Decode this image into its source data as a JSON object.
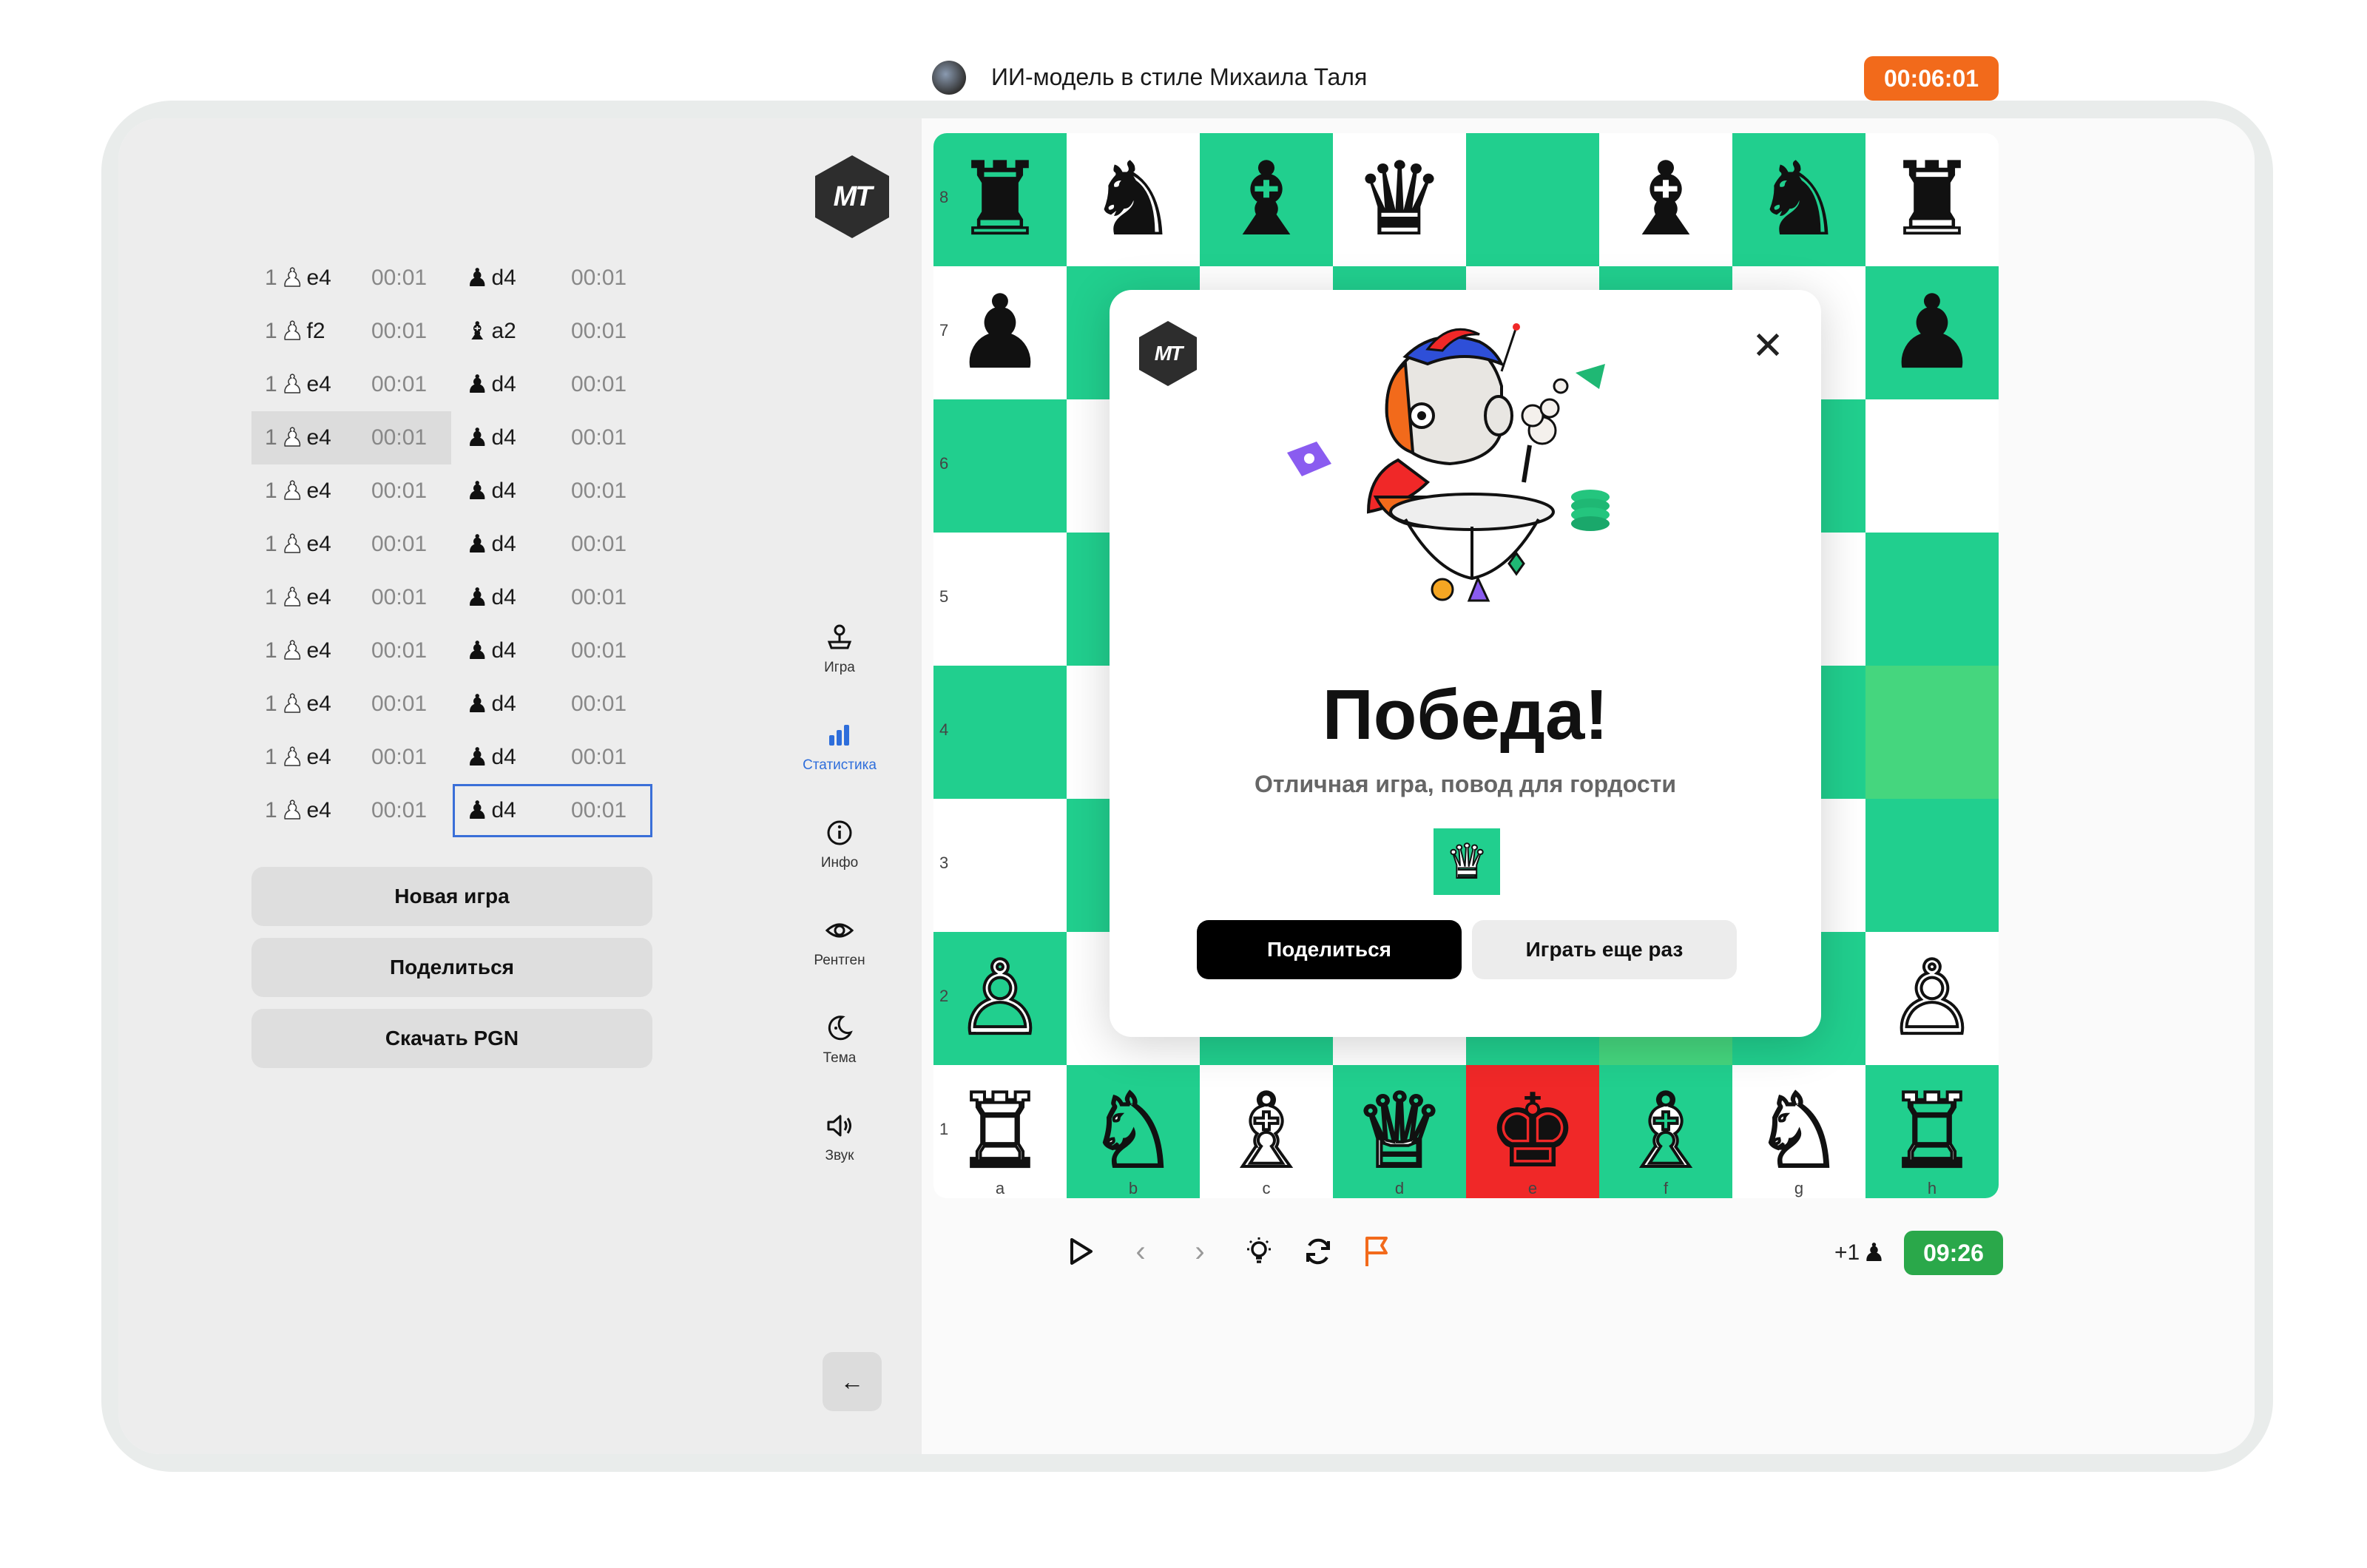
{
  "brand": {
    "logo_text": "MT"
  },
  "moves": [
    {
      "num": "1",
      "white": "e4",
      "white_piece": "pawn",
      "white_time": "00:01",
      "black": "d4",
      "black_piece": "pawn",
      "black_time": "00:01"
    },
    {
      "num": "1",
      "white": "f2",
      "white_piece": "pawn",
      "white_time": "00:01",
      "black": "a2",
      "black_piece": "bishop",
      "black_time": "00:01"
    },
    {
      "num": "1",
      "white": "e4",
      "white_piece": "pawn",
      "white_time": "00:01",
      "black": "d4",
      "black_piece": "pawn",
      "black_time": "00:01"
    },
    {
      "num": "1",
      "white": "e4",
      "white_piece": "pawn",
      "white_time": "00:01",
      "black": "d4",
      "black_piece": "pawn",
      "black_time": "00:01"
    },
    {
      "num": "1",
      "white": "e4",
      "white_piece": "pawn",
      "white_time": "00:01",
      "black": "d4",
      "black_piece": "pawn",
      "black_time": "00:01"
    },
    {
      "num": "1",
      "white": "e4",
      "white_piece": "pawn",
      "white_time": "00:01",
      "black": "d4",
      "black_piece": "pawn",
      "black_time": "00:01"
    },
    {
      "num": "1",
      "white": "e4",
      "white_piece": "pawn",
      "white_time": "00:01",
      "black": "d4",
      "black_piece": "pawn",
      "black_time": "00:01"
    },
    {
      "num": "1",
      "white": "e4",
      "white_piece": "pawn",
      "white_time": "00:01",
      "black": "d4",
      "black_piece": "pawn",
      "black_time": "00:01"
    },
    {
      "num": "1",
      "white": "e4",
      "white_piece": "pawn",
      "white_time": "00:01",
      "black": "d4",
      "black_piece": "pawn",
      "black_time": "00:01"
    },
    {
      "num": "1",
      "white": "e4",
      "white_piece": "pawn",
      "white_time": "00:01",
      "black": "d4",
      "black_piece": "pawn",
      "black_time": "00:01"
    },
    {
      "num": "1",
      "white": "e4",
      "white_piece": "pawn",
      "white_time": "00:01",
      "black": "d4",
      "black_piece": "pawn",
      "black_time": "00:01"
    }
  ],
  "actions": {
    "new_game": "Новая игра",
    "share": "Поделиться",
    "download_pgn": "Скачать PGN"
  },
  "nav": [
    {
      "label": "Игра",
      "icon": "joystick-icon"
    },
    {
      "label": "Статистика",
      "icon": "bar-chart-icon",
      "active": true
    },
    {
      "label": "Инфо",
      "icon": "info-icon"
    },
    {
      "label": "Рентген",
      "icon": "eye-icon"
    },
    {
      "label": "Тема",
      "icon": "moon-icon"
    },
    {
      "label": "Звук",
      "icon": "speaker-icon"
    }
  ],
  "opponent": {
    "name": "ИИ-модель в стиле Михаила Таля",
    "timer": "00:06:01"
  },
  "player": {
    "timer": "09:26",
    "advantage": "+1"
  },
  "board": {
    "ranks": [
      "8",
      "7",
      "6",
      "5",
      "4",
      "3",
      "2",
      "1"
    ],
    "files": [
      "a",
      "b",
      "c",
      "d",
      "e",
      "f",
      "g",
      "h"
    ],
    "colors": {
      "light": "#ffffff",
      "dark": "#21cf8e",
      "check": "#f02828",
      "last_move": "#45d67e"
    }
  },
  "modal": {
    "logo_text": "MT",
    "title": "Победа!",
    "subtitle": "Отличная игра, повод для гордости",
    "share": "Поделиться",
    "play_again": "Играть еще раз"
  },
  "colors": {
    "accent_blue": "#2e6edb",
    "timer_orange": "#f26a1b",
    "timer_green": "#2aa84a"
  }
}
